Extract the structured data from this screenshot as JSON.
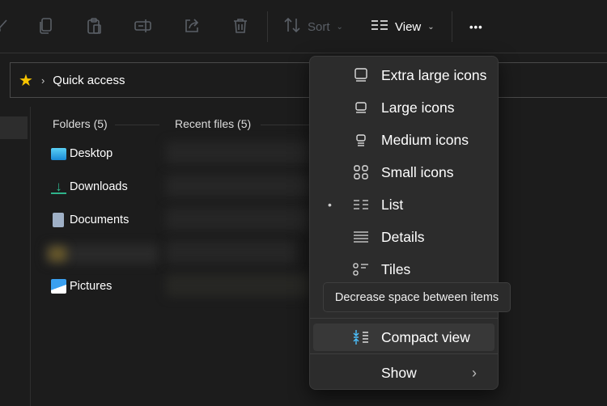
{
  "toolbar": {
    "sort_label": "Sort",
    "view_label": "View",
    "more_label": "•••"
  },
  "address": {
    "location": "Quick access"
  },
  "sections": {
    "folders_header": "Folders (5)",
    "recent_header": "Recent files (5)"
  },
  "folders": [
    {
      "label": "Desktop"
    },
    {
      "label": "Downloads"
    },
    {
      "label": "Documents"
    },
    {
      "label": "Pictures"
    }
  ],
  "view_menu": {
    "items": [
      {
        "label": "Extra large icons"
      },
      {
        "label": "Large icons"
      },
      {
        "label": "Medium icons"
      },
      {
        "label": "Small icons"
      },
      {
        "label": "List",
        "selected": true
      },
      {
        "label": "Details"
      },
      {
        "label": "Tiles"
      }
    ],
    "compact": "Compact view",
    "show": "Show",
    "selected_bullet": "•"
  },
  "tooltip": "Decrease space between items",
  "colors": {
    "accent": "#4cc2ff",
    "star": "#f7c400",
    "download": "#2fb38b"
  }
}
